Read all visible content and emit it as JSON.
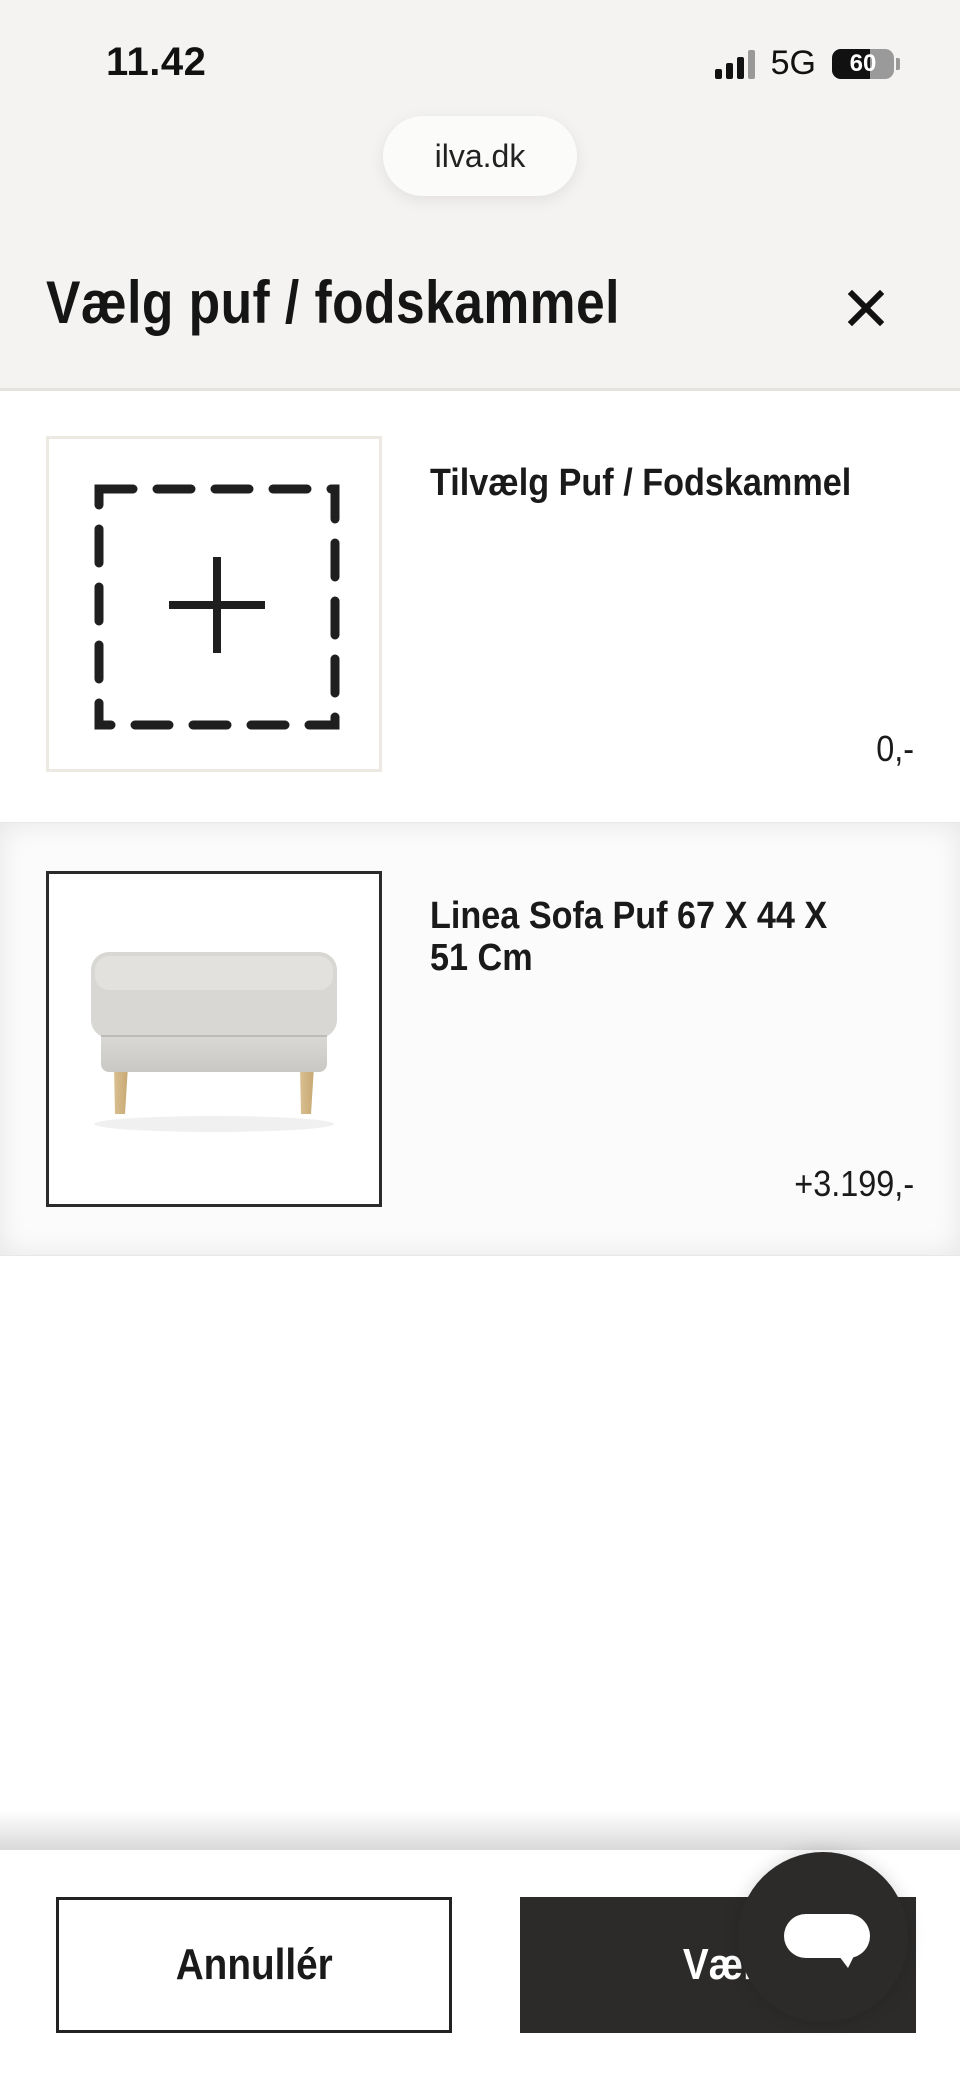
{
  "status_bar": {
    "time": "11.42",
    "network": "5G",
    "battery": "60",
    "battery_level": 0.6
  },
  "browser": {
    "url": "ilva.dk"
  },
  "modal": {
    "title": "Vælg puf / fodskammel",
    "close_icon": "close-icon"
  },
  "options": [
    {
      "name": "Tilvælg Puf / Fodskammel",
      "price": "0,-",
      "image": "add-placeholder-icon",
      "selected": false
    },
    {
      "name": "Linea Sofa Puf 67 X 44 X 51 Cm",
      "price": "+3.199,-",
      "image": "footstool-image",
      "selected": true
    }
  ],
  "actions": {
    "cancel_label": "Annullér",
    "choose_label": "Væl",
    "chat_icon": "chat-bubble-icon"
  },
  "colors": {
    "header_bg": "#f4f3f1",
    "primary_button": "#2c2b2a",
    "text": "#1a1a1a"
  }
}
